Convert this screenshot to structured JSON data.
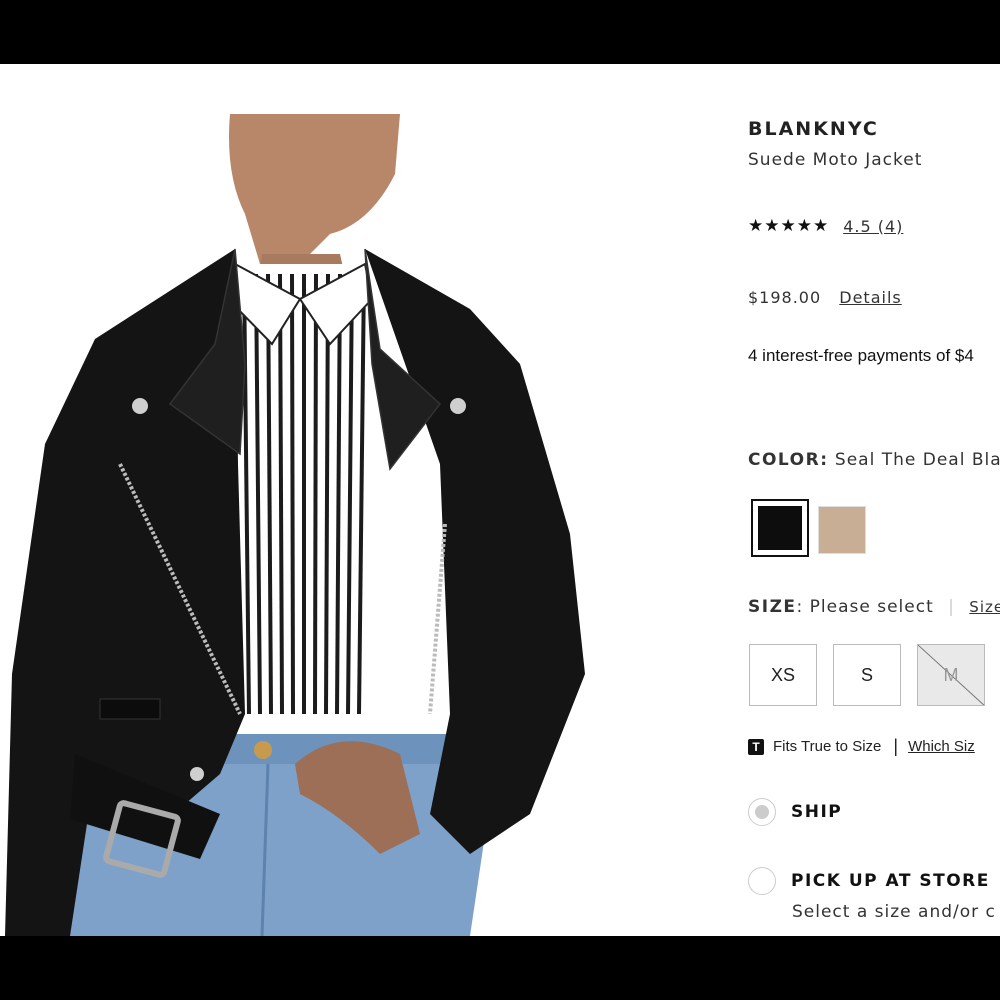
{
  "product": {
    "brand": "BLANKNYC",
    "name": "Suede Moto Jacket",
    "image_alt": "Model wearing black suede moto jacket over striped shirt and jeans"
  },
  "rating": {
    "stars": "★★★★★",
    "value": 4.5,
    "link_text": "4.5 (4)"
  },
  "price": {
    "amount": "$198.00",
    "details_label": "Details"
  },
  "installments": {
    "text": "4 interest-free payments of $4"
  },
  "color": {
    "label": "COLOR:",
    "selected": "Seal The Deal Bla",
    "swatches": [
      {
        "name": "black",
        "color": "#0d0d0d",
        "selected": true
      },
      {
        "name": "tan",
        "color": "#c8ae95",
        "selected": false
      }
    ]
  },
  "size": {
    "label": "SIZE",
    "colon": ":",
    "prompt": "Please select",
    "guide_label": "Size",
    "options": [
      {
        "label": "XS",
        "available": true
      },
      {
        "label": "S",
        "available": true
      },
      {
        "label": "M",
        "available": false
      }
    ]
  },
  "fit": {
    "icon_letter": "T",
    "text": "Fits True to Size",
    "separator": "|",
    "which_link": "Which Siz"
  },
  "fulfillment": {
    "ship_label": "SHIP",
    "pickup_label": "PICK UP AT STORE",
    "pickup_sub": "Select a size and/or c"
  }
}
